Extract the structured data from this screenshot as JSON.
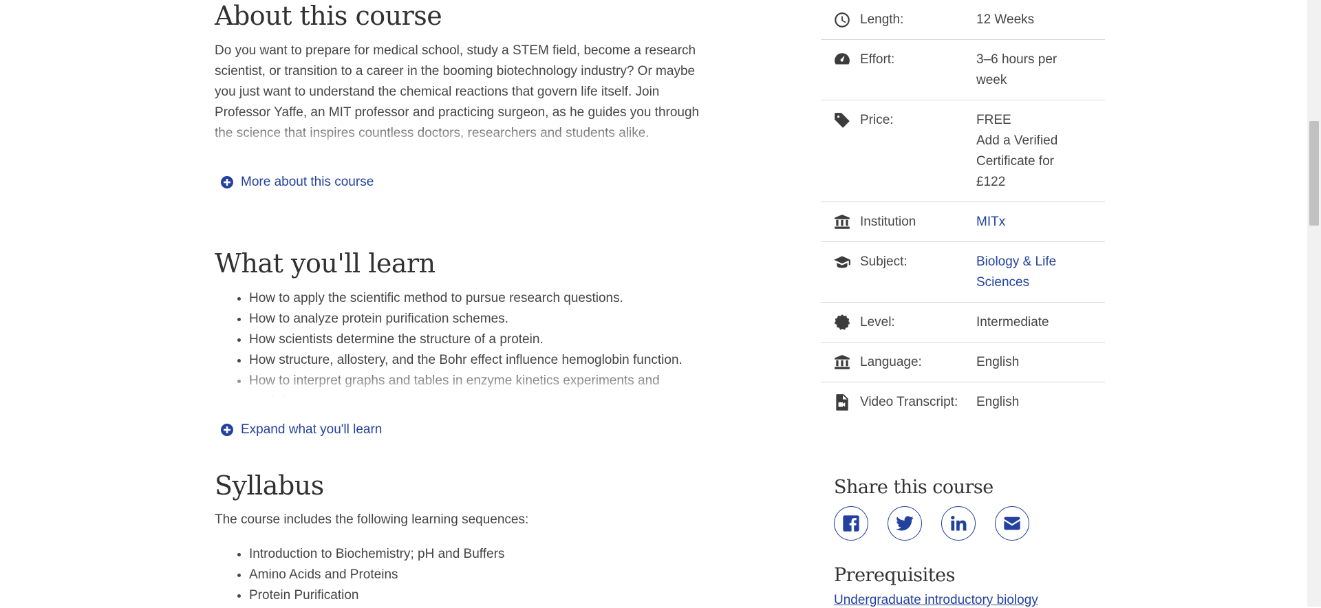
{
  "about": {
    "heading": "About this course",
    "text": "Do you want to prepare for medical school, study a STEM field, become a research scientist, or transition to a career in the booming biotechnology industry? Or maybe you just want to understand the chemical reactions that govern life itself. Join Professor Yaffe, an MIT professor and practicing surgeon, as he guides you through the science that inspires countless doctors, researchers and students alike.",
    "more_label": "More about this course"
  },
  "learn": {
    "heading": "What you'll learn",
    "items": [
      "How to apply the scientific method to pursue research questions.",
      "How to analyze protein purification schemes.",
      "How scientists determine the structure of a protein.",
      "How structure, allostery, and the Bohr effect influence hemoglobin function.",
      "How to interpret graphs and tables in enzyme kinetics experiments and models"
    ],
    "expand_label": "Expand what you'll learn"
  },
  "syllabus": {
    "heading": "Syllabus",
    "intro": "The course includes the following learning sequences:",
    "items": [
      "Introduction to Biochemistry; pH and Buffers",
      "Amino Acids and Proteins",
      "Protein Purification"
    ]
  },
  "details": [
    {
      "icon": "clock-icon",
      "label": "Length:",
      "value": "12 Weeks",
      "link": false
    },
    {
      "icon": "gauge-icon",
      "label": "Effort:",
      "value": "3–6 hours per week",
      "link": false
    },
    {
      "icon": "tag-icon",
      "label": "Price:",
      "value": "FREE",
      "extra": "Add a Verified Certificate for £122",
      "link": false
    },
    {
      "icon": "institution-icon",
      "label": "Institution",
      "value": "MITx",
      "link": true
    },
    {
      "icon": "graduation-cap-icon",
      "label": "Subject:",
      "value": "Biology & Life Sciences",
      "link": true
    },
    {
      "icon": "badge-icon",
      "label": "Level:",
      "value": "Intermediate",
      "link": false
    },
    {
      "icon": "institution-icon",
      "label": "Language:",
      "value": "English",
      "link": false
    },
    {
      "icon": "video-file-icon",
      "label": "Video Transcript:",
      "value": "English",
      "link": false
    }
  ],
  "share": {
    "heading": "Share this course",
    "icons": [
      "facebook-icon",
      "twitter-icon",
      "linkedin-icon",
      "email-icon"
    ]
  },
  "prerequisites": {
    "heading": "Prerequisites",
    "link": "Undergraduate introductory biology"
  },
  "colors": {
    "link": "#23419f",
    "text": "#454545",
    "heading": "#313131"
  }
}
